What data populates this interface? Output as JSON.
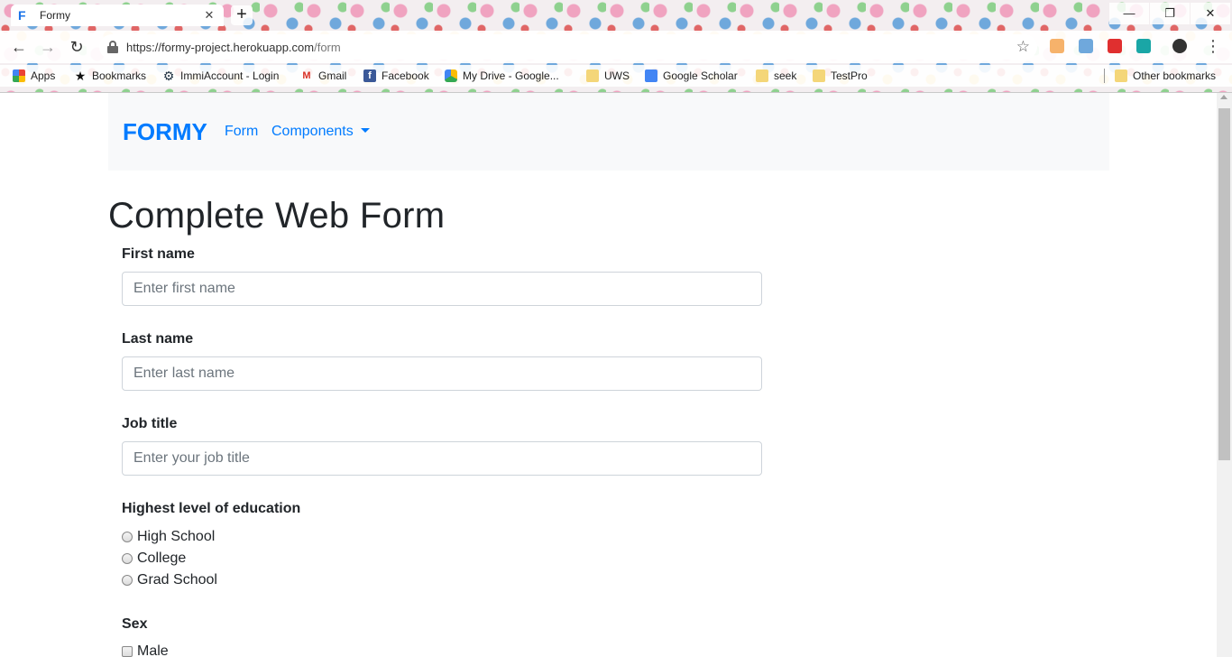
{
  "browser": {
    "tab": {
      "favicon": "F",
      "title": "Formy",
      "close": "✕"
    },
    "new_tab": "+",
    "window_controls": {
      "minimize": "—",
      "restore": "❐",
      "close": "✕"
    },
    "nav": {
      "back": "←",
      "forward": "→",
      "reload": "↻"
    },
    "url": {
      "host": "https://formy-project.herokuapp.com",
      "path": "/form"
    },
    "star": "☆",
    "menu": "⋮",
    "bookmarks": [
      {
        "label": "Apps",
        "icon": "apps-grid-icon"
      },
      {
        "label": "Bookmarks",
        "icon": "star-icon"
      },
      {
        "label": "ImmiAccount - Login",
        "icon": "gear-icon"
      },
      {
        "label": "Gmail",
        "icon": "gmail-icon"
      },
      {
        "label": "Facebook",
        "icon": "facebook-icon"
      },
      {
        "label": "My Drive - Google...",
        "icon": "drive-icon"
      },
      {
        "label": "UWS",
        "icon": "folder-icon"
      },
      {
        "label": "Google Scholar",
        "icon": "scholar-icon"
      },
      {
        "label": "seek",
        "icon": "folder-icon"
      },
      {
        "label": "TestPro",
        "icon": "folder-icon"
      }
    ],
    "other_bookmarks": "Other bookmarks"
  },
  "navbar": {
    "brand": "FORMY",
    "links": [
      "Form",
      "Components"
    ]
  },
  "form": {
    "title": "Complete Web Form",
    "first_name": {
      "label": "First name",
      "placeholder": "Enter first name"
    },
    "last_name": {
      "label": "Last name",
      "placeholder": "Enter last name"
    },
    "job_title": {
      "label": "Job title",
      "placeholder": "Enter your job title"
    },
    "education": {
      "label": "Highest level of education",
      "options": [
        "High School",
        "College",
        "Grad School"
      ]
    },
    "sex": {
      "label": "Sex",
      "options": [
        "Male"
      ]
    }
  },
  "colors": {
    "brand": "#007bff",
    "text": "#212529",
    "navbar_bg": "#f8f9fa"
  }
}
